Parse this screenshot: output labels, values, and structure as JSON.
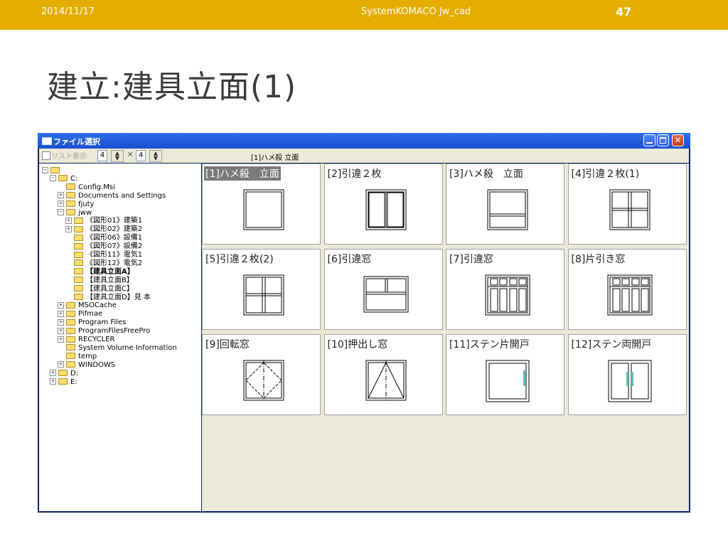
{
  "slide": {
    "date": "2014/11/17",
    "header_title": "SystemKOMACO Jw_cad",
    "page_number": "47",
    "title": "建立:建具立面(1)",
    "colors": {
      "header_bg": "#e5ad00",
      "title": "#3b3b3b"
    }
  },
  "window": {
    "title": "ファイル選択",
    "toolbar": {
      "list_label": "リスト表示",
      "cols": "4",
      "rows": "4",
      "current_file": "[1]ハメ殺 立面"
    }
  },
  "tree": [
    {
      "label": "",
      "level": 0,
      "expander": "-"
    },
    {
      "label": "C:",
      "level": 1,
      "expander": "-"
    },
    {
      "label": "Config.Msi",
      "level": 2,
      "expander": ""
    },
    {
      "label": "Documents and Settings",
      "level": 2,
      "expander": "+"
    },
    {
      "label": "fjuty",
      "level": 2,
      "expander": "+"
    },
    {
      "label": "jww",
      "level": 2,
      "expander": "-"
    },
    {
      "label": "《図形01》建築1",
      "level": 3,
      "expander": "+"
    },
    {
      "label": "《図形02》建築2",
      "level": 3,
      "expander": "+"
    },
    {
      "label": "《図形06》設備1",
      "level": 3,
      "expander": ""
    },
    {
      "label": "《図形07》設備2",
      "level": 3,
      "expander": ""
    },
    {
      "label": "《図形11》電気1",
      "level": 3,
      "expander": ""
    },
    {
      "label": "《図形12》電気2",
      "level": 3,
      "expander": ""
    },
    {
      "label": "【建具立面A】",
      "level": 3,
      "expander": "",
      "bold": true
    },
    {
      "label": "【建具立面B】",
      "level": 3,
      "expander": ""
    },
    {
      "label": "【建具立面C】",
      "level": 3,
      "expander": ""
    },
    {
      "label": "【建具立面D】見 本",
      "level": 3,
      "expander": ""
    },
    {
      "label": "MSOCache",
      "level": 2,
      "expander": "+"
    },
    {
      "label": "Pifmae",
      "level": 2,
      "expander": "+"
    },
    {
      "label": "Program Files",
      "level": 2,
      "expander": "+"
    },
    {
      "label": "ProgramFilesFreePro",
      "level": 2,
      "expander": "+"
    },
    {
      "label": "RECYCLER",
      "level": 2,
      "expander": "+"
    },
    {
      "label": "System Volume Information",
      "level": 2,
      "expander": ""
    },
    {
      "label": "temp",
      "level": 2,
      "expander": ""
    },
    {
      "label": "WINDOWS",
      "level": 2,
      "expander": "+"
    },
    {
      "label": "D:",
      "level": 1,
      "expander": "+"
    },
    {
      "label": "E:",
      "level": 1,
      "expander": "+"
    }
  ],
  "thumbnails": [
    {
      "label": "[1]ハメ殺　立面",
      "icon": "fixed-window-icon",
      "selected": true
    },
    {
      "label": "[2]引違２枚",
      "icon": "sliding-two-panel-icon"
    },
    {
      "label": "[3]ハメ殺　立面",
      "icon": "fixed-window-transom-icon"
    },
    {
      "label": "[4]引違２枚(1)",
      "icon": "sliding-two-panel-transom-icon"
    },
    {
      "label": "[5]引違２枚(2)",
      "icon": "sliding-four-pane-icon"
    },
    {
      "label": "[6]引違窓",
      "icon": "sliding-window-lower-fixed-icon"
    },
    {
      "label": "[7]引違窓",
      "icon": "sliding-window-eight-pane-icon"
    },
    {
      "label": "[8]片引き窓",
      "icon": "single-sliding-window-icon"
    },
    {
      "label": "[9]回転窓",
      "icon": "pivot-window-icon"
    },
    {
      "label": "[10]押出し窓",
      "icon": "awning-window-icon"
    },
    {
      "label": "[11]ステン片開戸",
      "icon": "steel-single-door-icon"
    },
    {
      "label": "[12]ステン両開戸",
      "icon": "steel-double-door-icon"
    }
  ]
}
